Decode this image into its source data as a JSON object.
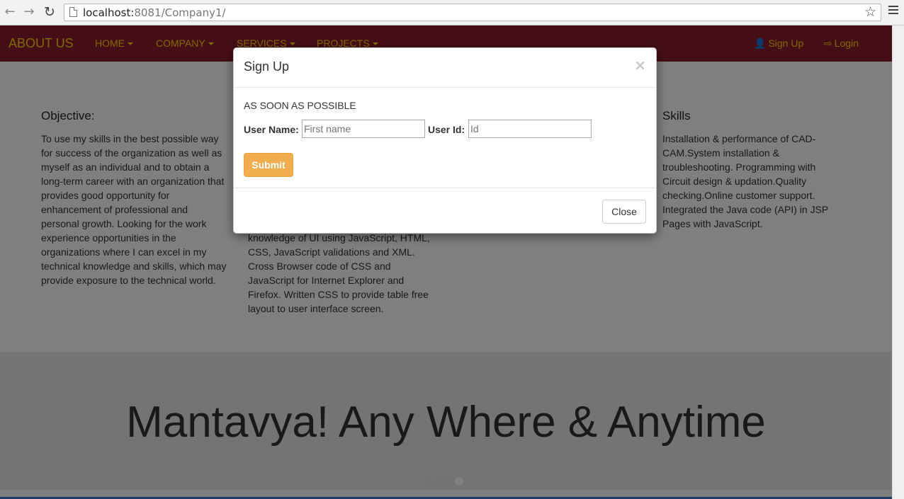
{
  "browser": {
    "url_host": "localhost:",
    "url_rest": "8081/Company1/",
    "back_icon": "←",
    "forward_icon": "→",
    "reload_icon": "↻",
    "star_icon": "☆"
  },
  "navbar": {
    "brand": "ABOUT US",
    "items": [
      {
        "label": "HOME"
      },
      {
        "label": "COMPANY"
      },
      {
        "label": "SERVICES"
      },
      {
        "label": "PROJECTS"
      }
    ],
    "signup": "Sign Up",
    "login": "Login",
    "signup_icon": "👤",
    "login_icon": "⇨",
    "color_bg": "#8b1c2c",
    "color_text": "#ffd800"
  },
  "content": {
    "col1": {
      "title": "Objective:",
      "text": "To use my skills in the best possible way for success of the organization as well as myself as an individual and to obtain a long-term career with an organization that provides good opportunity for enhancement of professional and personal growth. Looking for the work experience opportunities in the organizations where I can excel in my technical knowledge and skills, which may provide exposure to the technical world."
    },
    "col2": {
      "text": "knowledge of UI using JavaScript, HTML, CSS, JavaScript validations and XML. Cross Browser code of CSS and JavaScript for Internet Explorer and Firefox. Written CSS to provide table free layout to user interface screen."
    },
    "col3": {
      "title": "Skills",
      "text": "Installation & performance of CAD-CAM.System installation & troubleshooting. Programming with Circuit design & updation.Quality checking.Online customer support. Integrated the Java code (API) in JSP Pages with JavaScript."
    }
  },
  "carousel": {
    "caption": "Mantavya! Any Where & Anytime"
  },
  "modal": {
    "title": "Sign Up",
    "close_x": "×",
    "intro": "AS SOON AS POSSIBLE",
    "username_label": "User Name:",
    "username_placeholder": "First name",
    "userid_label": "User Id:",
    "userid_placeholder": "Id",
    "submit": "Submit",
    "close": "Close",
    "submit_color": "#f0ad4e"
  }
}
